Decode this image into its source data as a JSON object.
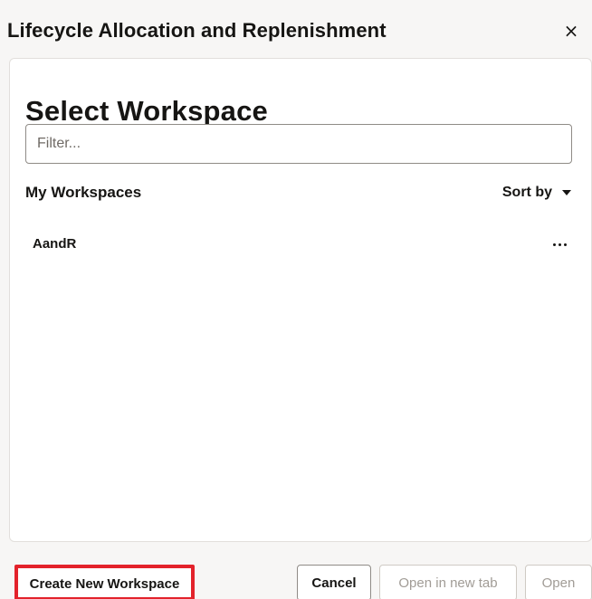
{
  "dialog": {
    "title": "Lifecycle Allocation and Replenishment",
    "close_icon": "×"
  },
  "panel": {
    "title": "Select Workspace",
    "filter": {
      "placeholder": "Filter...",
      "value": ""
    },
    "section_label": "My Workspaces",
    "sort_label": "Sort by",
    "workspaces": [
      {
        "name": "AandR",
        "menu_icon": "more-actions-icon"
      }
    ]
  },
  "footer": {
    "create_label": "Create New Workspace",
    "cancel_label": "Cancel",
    "open_new_tab_label": "Open in new tab",
    "open_label": "Open"
  },
  "colors": {
    "highlight": "#e3222b",
    "panel_background": "#ffffff",
    "dialog_background": "#f7f6f5",
    "disabled_text": "#a19c96"
  }
}
